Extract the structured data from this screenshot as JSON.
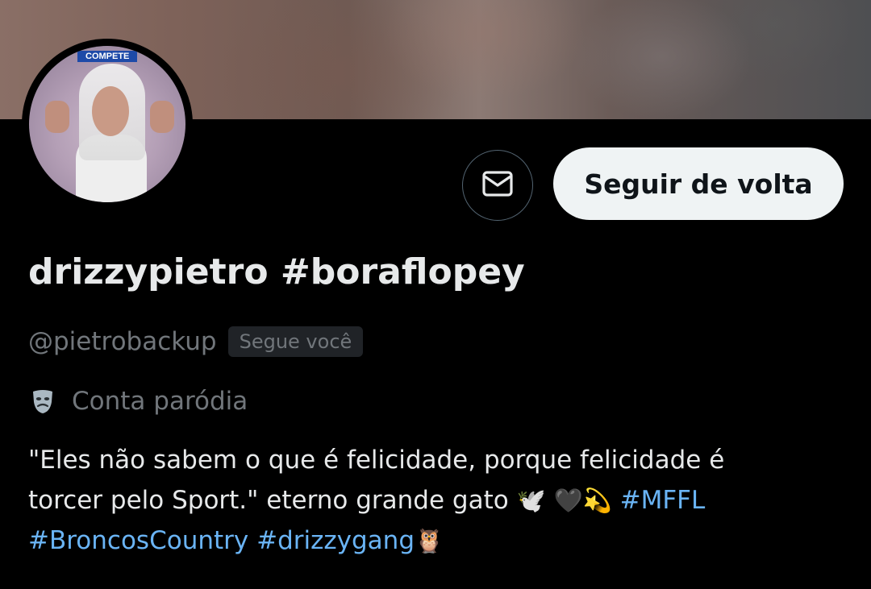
{
  "profile": {
    "display_name": "drizzypietro #boraflopey",
    "handle": "@pietrobackup",
    "follows_you_badge": "Segue você",
    "parody_label": "Conta paródia",
    "avatar_sign_text": "COMPETE",
    "bio": {
      "text_line1": "\"Eles não sabem o que é felicidade, porque felicidade é",
      "text_line2": "torcer pelo Sport.\" eterno grande gato ",
      "emoji_1": "🕊️",
      "emoji_2": "🖤",
      "emoji_3": "💫",
      "hashtag_1": "#MFFL",
      "hashtag_2": "#BroncosCountry",
      "hashtag_3": "#drizzygang",
      "emoji_4": "🦉"
    }
  },
  "actions": {
    "follow_back_label": "Seguir de volta"
  },
  "icons": {
    "dm": "envelope-icon",
    "parody": "theater-mask-icon"
  },
  "colors": {
    "background": "#000000",
    "text_primary": "#e7e9ea",
    "text_secondary": "#71767b",
    "link": "#6ab4f5",
    "button_bg": "#eff3f4"
  }
}
